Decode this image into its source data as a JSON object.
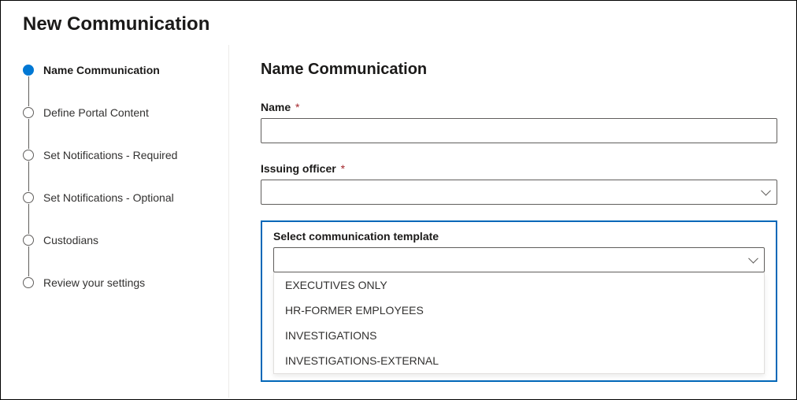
{
  "pageTitle": "New Communication",
  "steps": [
    {
      "label": "Name Communication",
      "active": true
    },
    {
      "label": "Define Portal Content",
      "active": false
    },
    {
      "label": "Set Notifications - Required",
      "active": false
    },
    {
      "label": "Set Notifications - Optional",
      "active": false
    },
    {
      "label": "Custodians",
      "active": false
    },
    {
      "label": "Review your settings",
      "active": false
    }
  ],
  "main": {
    "heading": "Name Communication",
    "nameLabel": "Name",
    "nameValue": "",
    "issuingOfficerLabel": "Issuing officer",
    "issuingOfficerValue": "",
    "templateLabel": "Select communication template",
    "templateValue": "",
    "templateOptions": [
      "EXECUTIVES ONLY",
      "HR-FORMER EMPLOYEES",
      "INVESTIGATIONS",
      "INVESTIGATIONS-EXTERNAL"
    ],
    "requiredMark": "*"
  }
}
